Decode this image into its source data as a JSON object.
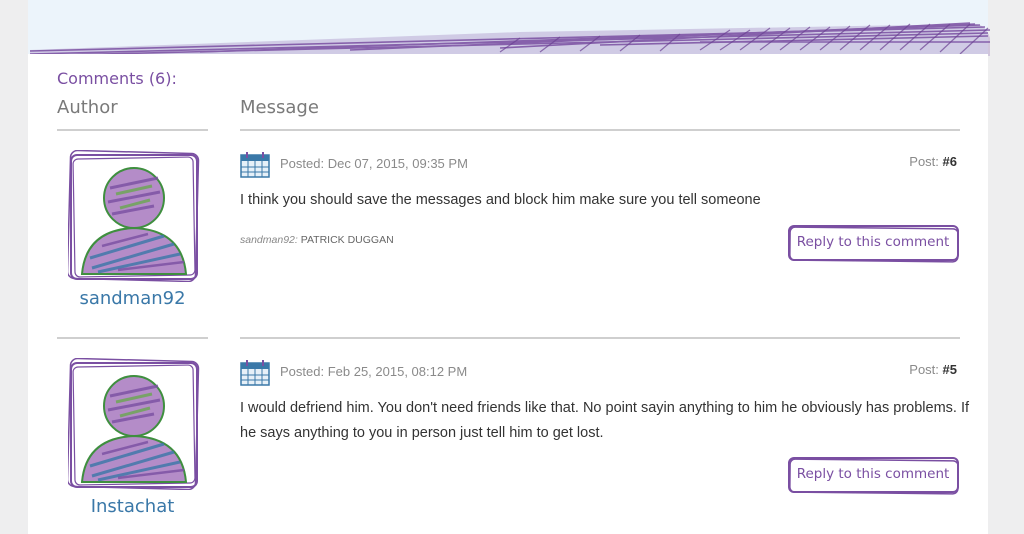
{
  "comments_header": {
    "title": "Comments (6):",
    "author_col": "Author",
    "message_col": "Message"
  },
  "comments": [
    {
      "username": "sandman92",
      "posted": "Posted: Dec 07, 2015, 09:35 PM",
      "post_label": "Post:",
      "post_number": "#6",
      "message": "I think you should save the messages and block him make sure you tell someone",
      "sig_user": "sandman92:",
      "sig_name": "PATRICK DUGGAN",
      "reply_label": "Reply to this comment"
    },
    {
      "username": "Instachat",
      "posted": "Posted: Feb 25, 2015, 08:12 PM",
      "post_label": "Post:",
      "post_number": "#5",
      "message": "I would defriend him. You don't need friends like that. No point sayin anything to him he obviously has problems. If he says anything to you in person just tell him to get lost.",
      "reply_label": "Reply to this comment"
    }
  ],
  "icons": {
    "calendar": "calendar-icon",
    "avatar": "default-avatar-icon"
  },
  "colors": {
    "accent_purple": "#7a4fa2",
    "username_blue": "#3a78a8",
    "top_band": "#ecf4fb"
  }
}
